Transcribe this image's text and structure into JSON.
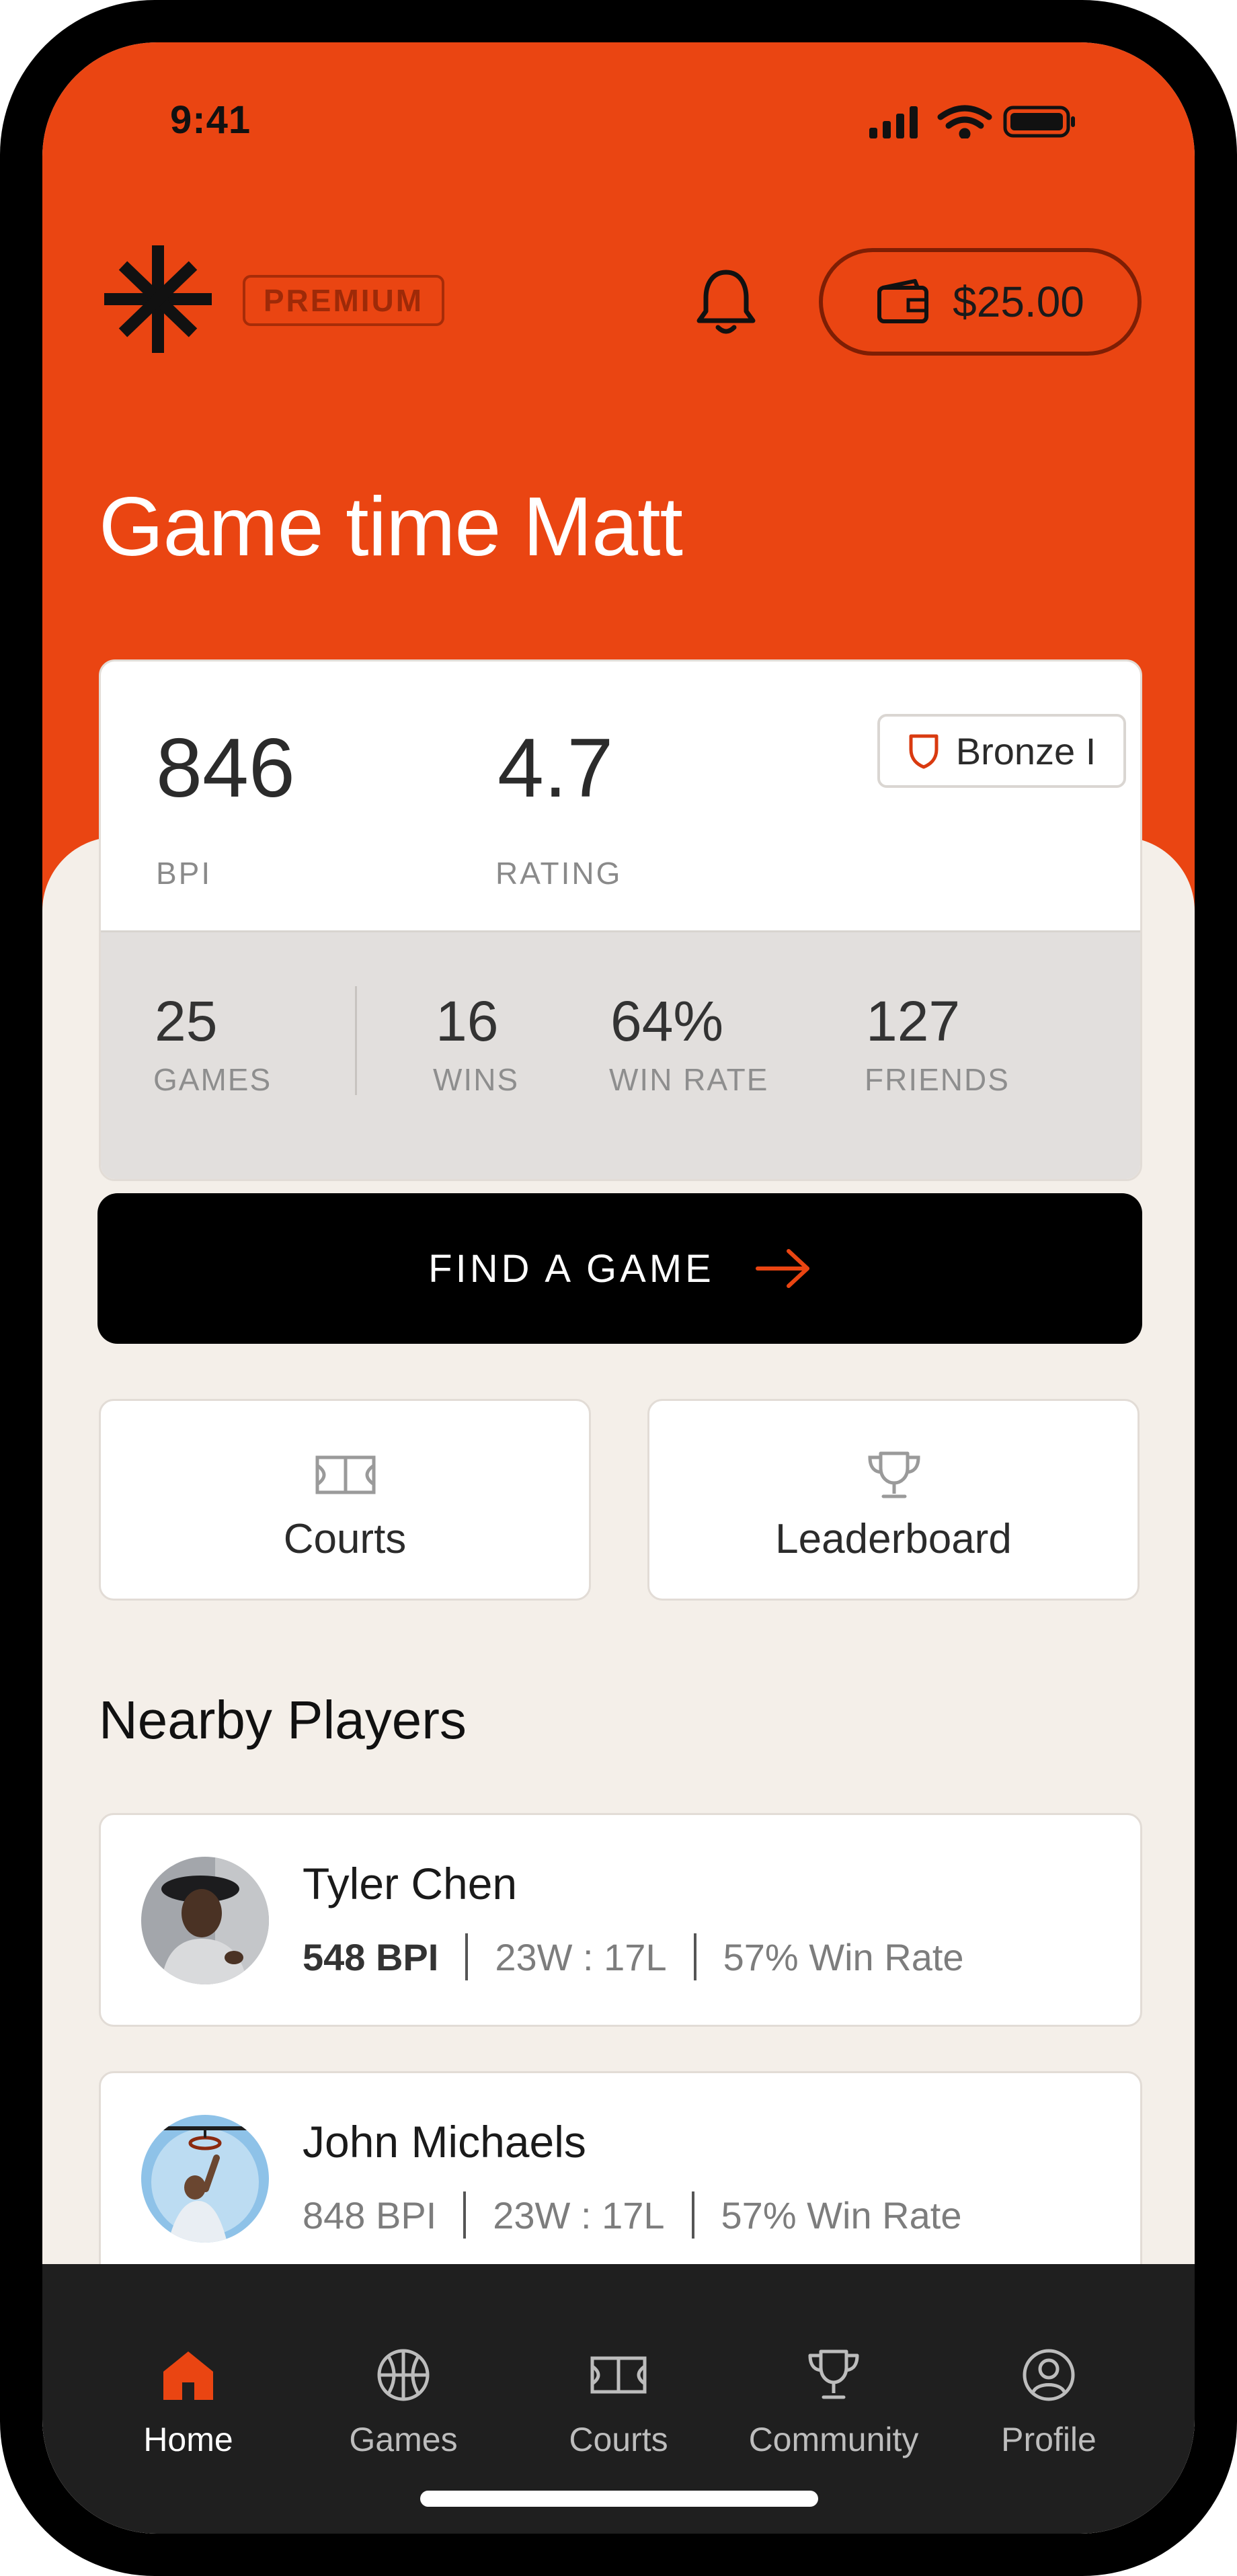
{
  "status_bar": {
    "time": "9:41"
  },
  "header": {
    "badge": "PREMIUM",
    "wallet_balance": "$25.00",
    "greeting": "Game time Matt"
  },
  "stats": {
    "bpi_value": "846",
    "bpi_label": "BPI",
    "rating_value": "4.7",
    "rating_label": "RATING",
    "tier": "Bronze I",
    "row": [
      {
        "value": "25",
        "label": "GAMES"
      },
      {
        "value": "16",
        "label": "WINS"
      },
      {
        "value": "64%",
        "label": "WIN RATE"
      },
      {
        "value": "127",
        "label": "FRIENDS"
      }
    ]
  },
  "actions": {
    "find_game": "FIND A GAME",
    "courts": "Courts",
    "leaderboard": "Leaderboard"
  },
  "nearby": {
    "title": "Nearby Players",
    "players": [
      {
        "name": "Tyler Chen",
        "bpi": "548 BPI",
        "record": "23W : 17L",
        "win_rate": "57% Win Rate"
      },
      {
        "name": "John Michaels",
        "bpi": "848 BPI",
        "record": "23W : 17L",
        "win_rate": "57% Win Rate"
      }
    ]
  },
  "tabs": [
    {
      "label": "Home",
      "icon": "home-icon",
      "active": true
    },
    {
      "label": "Games",
      "icon": "basketball-icon"
    },
    {
      "label": "Courts",
      "icon": "court-icon"
    },
    {
      "label": "Community",
      "icon": "trophy-icon"
    },
    {
      "label": "Profile",
      "icon": "profile-icon"
    }
  ],
  "colors": {
    "brand": "#EA4512",
    "background": "#F4EFE9",
    "tab_bar": "#1F1F1F"
  }
}
